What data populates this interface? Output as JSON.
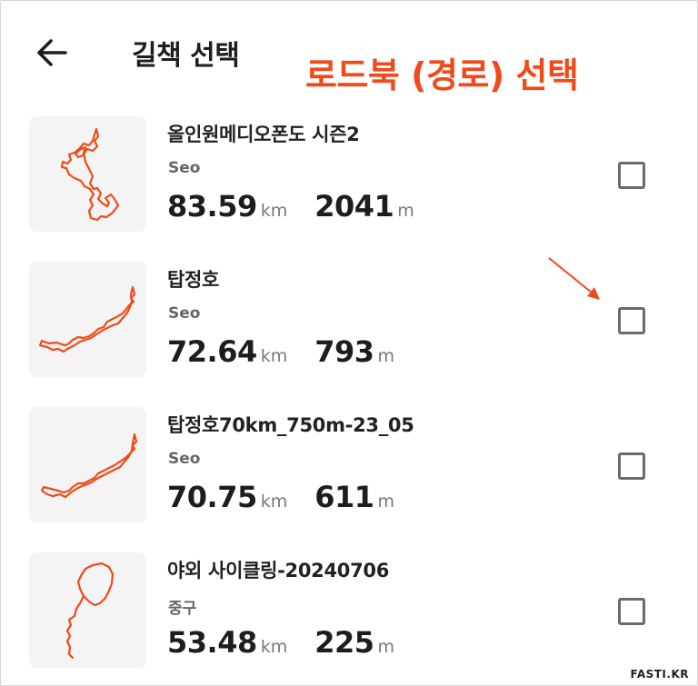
{
  "header": {
    "title": "길책 선택",
    "annotation": "로드북 (경로) 선택",
    "back_icon": "arrow-left-icon"
  },
  "colors": {
    "route_line": "#f04a1a",
    "annotation": "#f04a1a",
    "checkbox_border": "#6b6b6b",
    "thumb_bg": "#f4f4f4"
  },
  "routes": [
    {
      "name": "올인원메디오폰도 시즌2",
      "owner": "Seo",
      "distance": "83.59",
      "distance_unit": "km",
      "elevation": "2041",
      "elevation_unit": "m",
      "checked": false
    },
    {
      "name": "탑정호",
      "owner": "Seo",
      "distance": "72.64",
      "distance_unit": "km",
      "elevation": "793",
      "elevation_unit": "m",
      "checked": false
    },
    {
      "name": "탑정호70km_750m-23_05",
      "owner": "Seo",
      "distance": "70.75",
      "distance_unit": "km",
      "elevation": "611",
      "elevation_unit": "m",
      "checked": false
    },
    {
      "name": "야외 사이클링-20240706",
      "owner": "중구",
      "distance": "53.48",
      "distance_unit": "km",
      "elevation": "225",
      "elevation_unit": "m",
      "checked": false
    }
  ],
  "watermark": "FASTI.KR"
}
